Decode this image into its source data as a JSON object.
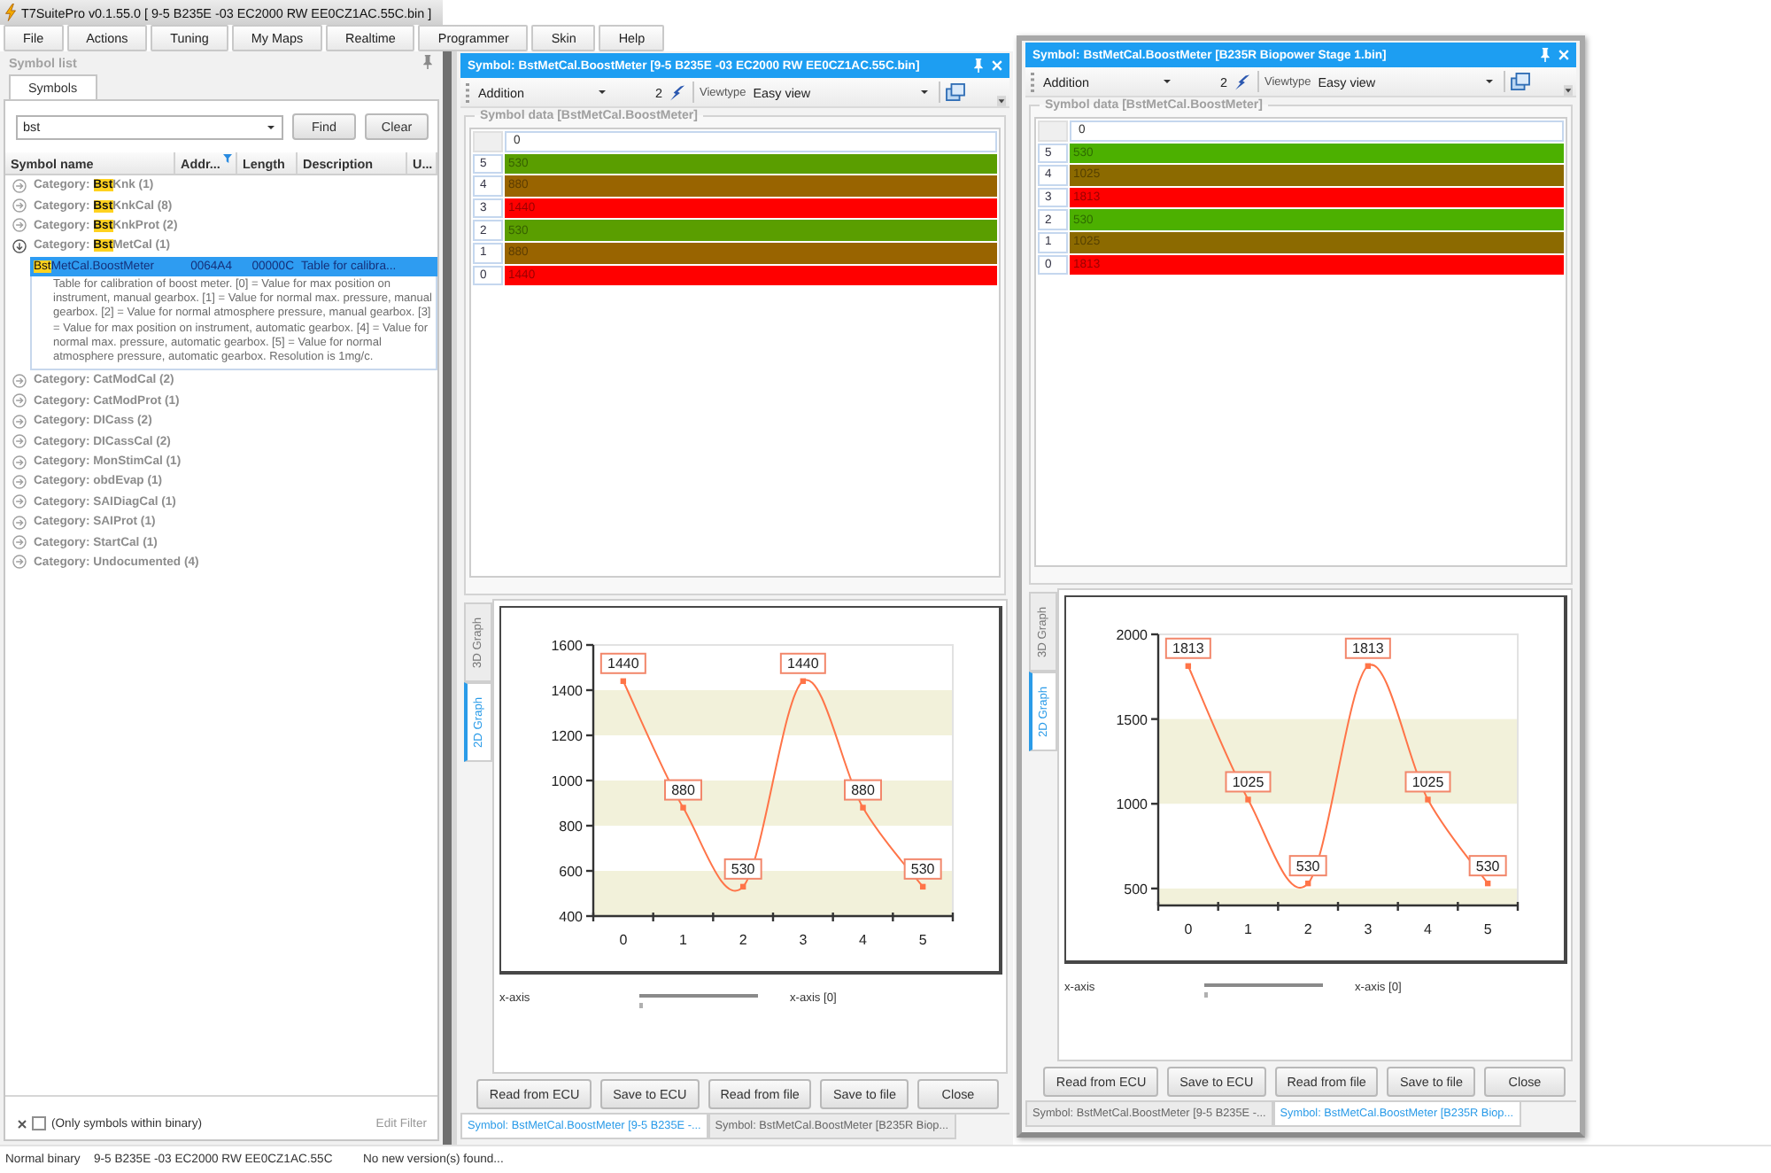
{
  "app": {
    "title": "T7SuitePro v0.1.55.0 [ 9-5 B235E -03 EC2000 RW EE0CZ1AC.55C.bin ]"
  },
  "menu": [
    "File",
    "Actions",
    "Tuning",
    "My Maps",
    "Realtime",
    "Programmer",
    "Skin",
    "Help"
  ],
  "symbol_list": {
    "title": "Symbol list",
    "tabs": [
      {
        "label": "Symbols",
        "selected": true
      }
    ],
    "search": {
      "value": "bst"
    },
    "search_buttons": [
      "Find",
      "Clear"
    ],
    "columns": [
      {
        "label": "Symbol name",
        "filtered": false
      },
      {
        "label": "Addr...",
        "filtered": true
      },
      {
        "label": "Length",
        "filtered": false
      },
      {
        "label": "Description",
        "filtered": false
      },
      {
        "label": "U...",
        "filtered": false
      }
    ],
    "categories": [
      {
        "label": {
          "text": "Category: ",
          "highlight": "Bst",
          "rest": "Knk (1)"
        },
        "expanded": false
      },
      {
        "label": {
          "text": "Category: ",
          "highlight": "Bst",
          "rest": "KnkCal (8)"
        },
        "expanded": false
      },
      {
        "label": {
          "text": "Category: ",
          "highlight": "Bst",
          "rest": "KnkProt (2)"
        },
        "expanded": false
      },
      {
        "label": {
          "text": "Category: ",
          "highlight": "Bst",
          "rest": "MetCal (1)"
        },
        "expanded": true,
        "symbols": [
          {
            "name": {
              "highlight": "Bst",
              "rest": "MetCal.BoostMeter"
            },
            "address": "0064A4",
            "length": "00000C",
            "description": "Table for calibra...",
            "selected": true,
            "details": "Table for calibration of boost meter. [0] = Value for max position on instrument, manual gearbox. [1] = Value for normal max. pressure, manual gearbox. [2] = Value for normal atmosphere pressure, manual gearbox. [3] = Value for max position on instrument, automatic gearbox. [4] = Value for normal max. pressure, automatic gearbox. [5] = Value for normal atmosphere pressure, automatic gearbox. Resolution is 1mg/c."
          }
        ]
      },
      {
        "label": {
          "text": "Category: CatModCal (2)"
        },
        "expanded": false
      },
      {
        "label": {
          "text": "Category: CatModProt (1)"
        },
        "expanded": false
      },
      {
        "label": {
          "text": "Category: DICass (2)"
        },
        "expanded": false
      },
      {
        "label": {
          "text": "Category: DICassCal (2)"
        },
        "expanded": false
      },
      {
        "label": {
          "text": "Category: MonStimCal (1)"
        },
        "expanded": false
      },
      {
        "label": {
          "text": "Category: obdEvap (1)"
        },
        "expanded": false
      },
      {
        "label": {
          "text": "Category: SAIDiagCal (1)"
        },
        "expanded": false
      },
      {
        "label": {
          "text": "Category: SAIProt (1)"
        },
        "expanded": false
      },
      {
        "label": {
          "text": "Category: StartCal (1)"
        },
        "expanded": false
      },
      {
        "label": {
          "text": "Category: Undocumented (4)"
        },
        "expanded": false
      }
    ],
    "filter": {
      "label": "(Only symbols within binary)",
      "checked": false,
      "edit_label": "Edit Filter"
    }
  },
  "symbol_windows": [
    {
      "title": "Symbol: BstMetCal.BoostMeter [9-5 B235E -03 EC2000 RW EE0CZ1AC.55C.bin]",
      "floating": false,
      "toolbar": {
        "operation": "Addition",
        "amount": "2",
        "viewtype_label": "Viewtype",
        "viewtype": "Easy view"
      },
      "group_title": "Symbol data [BstMetCal.BoostMeter]",
      "grid": {
        "column_header": "0",
        "rows": [
          {
            "index": "5",
            "value": "530",
            "color": "#5a9e00"
          },
          {
            "index": "4",
            "value": "880",
            "color": "#996400"
          },
          {
            "index": "3",
            "value": "1440",
            "color": "#ff0000"
          },
          {
            "index": "2",
            "value": "530",
            "color": "#5a9e00"
          },
          {
            "index": "1",
            "value": "880",
            "color": "#996400"
          },
          {
            "index": "0",
            "value": "1440",
            "color": "#ff0000"
          }
        ]
      },
      "graph_tabs": [
        {
          "label": "3D Graph",
          "selected": false
        },
        {
          "label": "2D Graph",
          "selected": true
        }
      ],
      "chart_data": {
        "type": "line",
        "categories": [
          "0",
          "1",
          "2",
          "3",
          "4",
          "5"
        ],
        "series": [
          {
            "color": "#ff7448",
            "marker": "square",
            "values": [
              1440,
              880,
              530,
              1440,
              880,
              530
            ]
          }
        ],
        "ylim": [
          400,
          1600
        ],
        "yticks": [
          400,
          600,
          800,
          1000,
          1200,
          1400,
          1600
        ],
        "data_labels": true
      },
      "axis_selector": {
        "label": "x-axis",
        "level": 0,
        "value": "x-axis [0]"
      },
      "buttons": [
        "Read from ECU",
        "Save to ECU",
        "Read from file",
        "Save to file",
        "Close"
      ],
      "doc_tabs": [
        {
          "label": "Symbol: BstMetCal.BoostMeter [9-5 B235E -...",
          "selected": true
        },
        {
          "label": "Symbol: BstMetCal.BoostMeter [B235R Biop...",
          "selected": false
        }
      ]
    },
    {
      "title": "Symbol: BstMetCal.BoostMeter [B235R Biopower Stage 1.bin]",
      "floating": true,
      "toolbar": {
        "operation": "Addition",
        "amount": "2",
        "viewtype_label": "Viewtype",
        "viewtype": "Easy view"
      },
      "group_title": "Symbol data [BstMetCal.BoostMeter]",
      "grid": {
        "column_header": "0",
        "rows": [
          {
            "index": "5",
            "value": "530",
            "color": "#4cb000"
          },
          {
            "index": "4",
            "value": "1025",
            "color": "#8c6a00"
          },
          {
            "index": "3",
            "value": "1813",
            "color": "#ff0000"
          },
          {
            "index": "2",
            "value": "530",
            "color": "#4cb000"
          },
          {
            "index": "1",
            "value": "1025",
            "color": "#8c6a00"
          },
          {
            "index": "0",
            "value": "1813",
            "color": "#ff0000"
          }
        ]
      },
      "graph_tabs": [
        {
          "label": "3D Graph",
          "selected": false
        },
        {
          "label": "2D Graph",
          "selected": true
        }
      ],
      "chart_data": {
        "type": "line",
        "categories": [
          "0",
          "1",
          "2",
          "3",
          "4",
          "5"
        ],
        "series": [
          {
            "color": "#ff7448",
            "marker": "square",
            "values": [
              1813,
              1025,
              530,
              1813,
              1025,
              530
            ]
          }
        ],
        "ylim": [
          400,
          2000
        ],
        "yticks": [
          500,
          1000,
          1500,
          2000
        ],
        "data_labels": true
      },
      "axis_selector": {
        "label": "x-axis",
        "level": 0,
        "value": "x-axis [0]"
      },
      "buttons": [
        "Read from ECU",
        "Save to ECU",
        "Read from file",
        "Save to file",
        "Close"
      ],
      "doc_tabs": [
        {
          "label": "Symbol: BstMetCal.BoostMeter [9-5 B235E -...",
          "selected": false
        },
        {
          "label": "Symbol: BstMetCal.BoostMeter [B235R Biop...",
          "selected": true
        }
      ]
    }
  ],
  "status_bar": [
    "Normal binary",
    "9-5 B235E -03 EC2000 RW EE0CZ1AC.55C",
    "No new version(s) found..."
  ]
}
